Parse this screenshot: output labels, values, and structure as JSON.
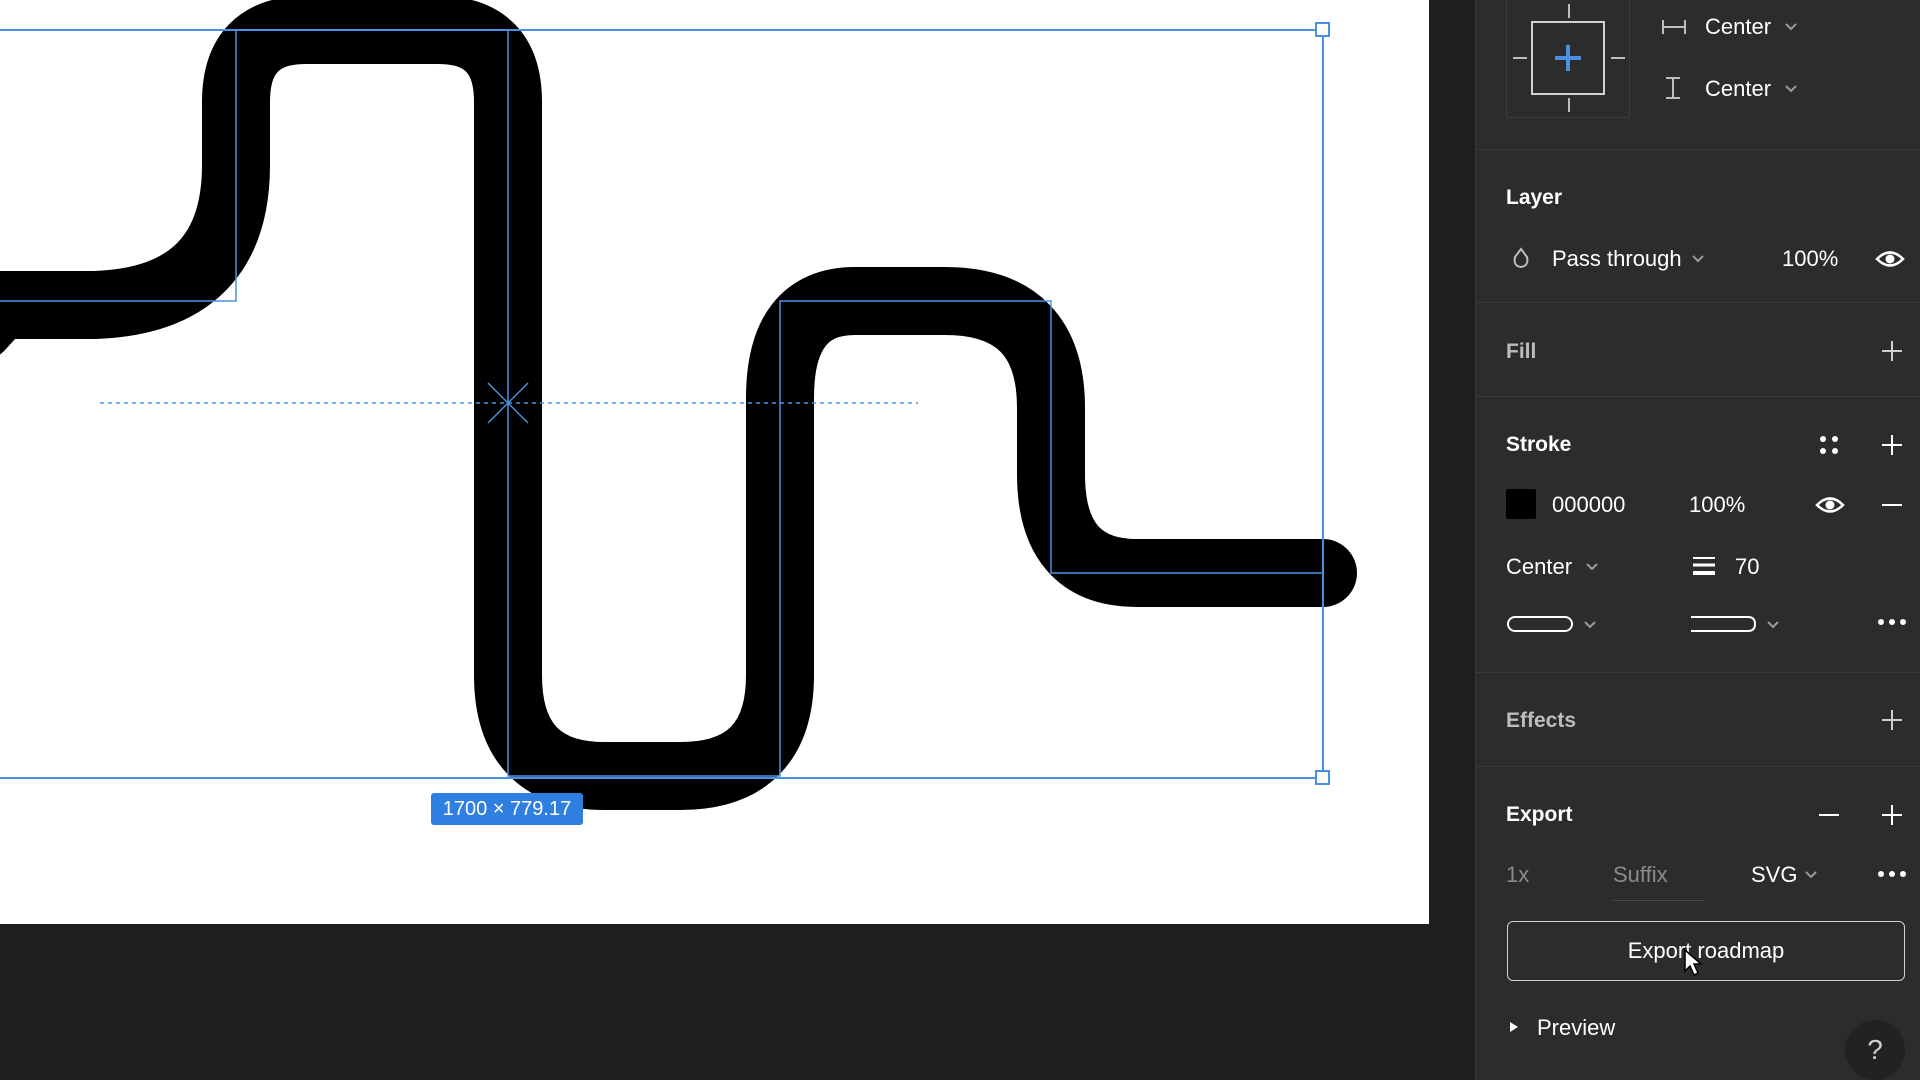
{
  "canvas": {
    "selection_size_label": "1700 × 779.17",
    "stroke_color": "#000000",
    "selection_color": "#4a90e2"
  },
  "constraints": {
    "horizontal_label": "Center",
    "vertical_label": "Center"
  },
  "layer": {
    "title": "Layer",
    "blend_mode": "Pass through",
    "opacity": "100%"
  },
  "fill": {
    "title": "Fill"
  },
  "stroke": {
    "title": "Stroke",
    "color_hex": "000000",
    "swatch_color": "#000000",
    "opacity": "100%",
    "position": "Center",
    "weight": "70"
  },
  "effects": {
    "title": "Effects"
  },
  "export": {
    "title": "Export",
    "scale": "1x",
    "suffix_placeholder": "Suffix",
    "format": "SVG",
    "button_label": "Export roadmap",
    "preview_label": "Preview"
  },
  "help": {
    "label": "?"
  }
}
